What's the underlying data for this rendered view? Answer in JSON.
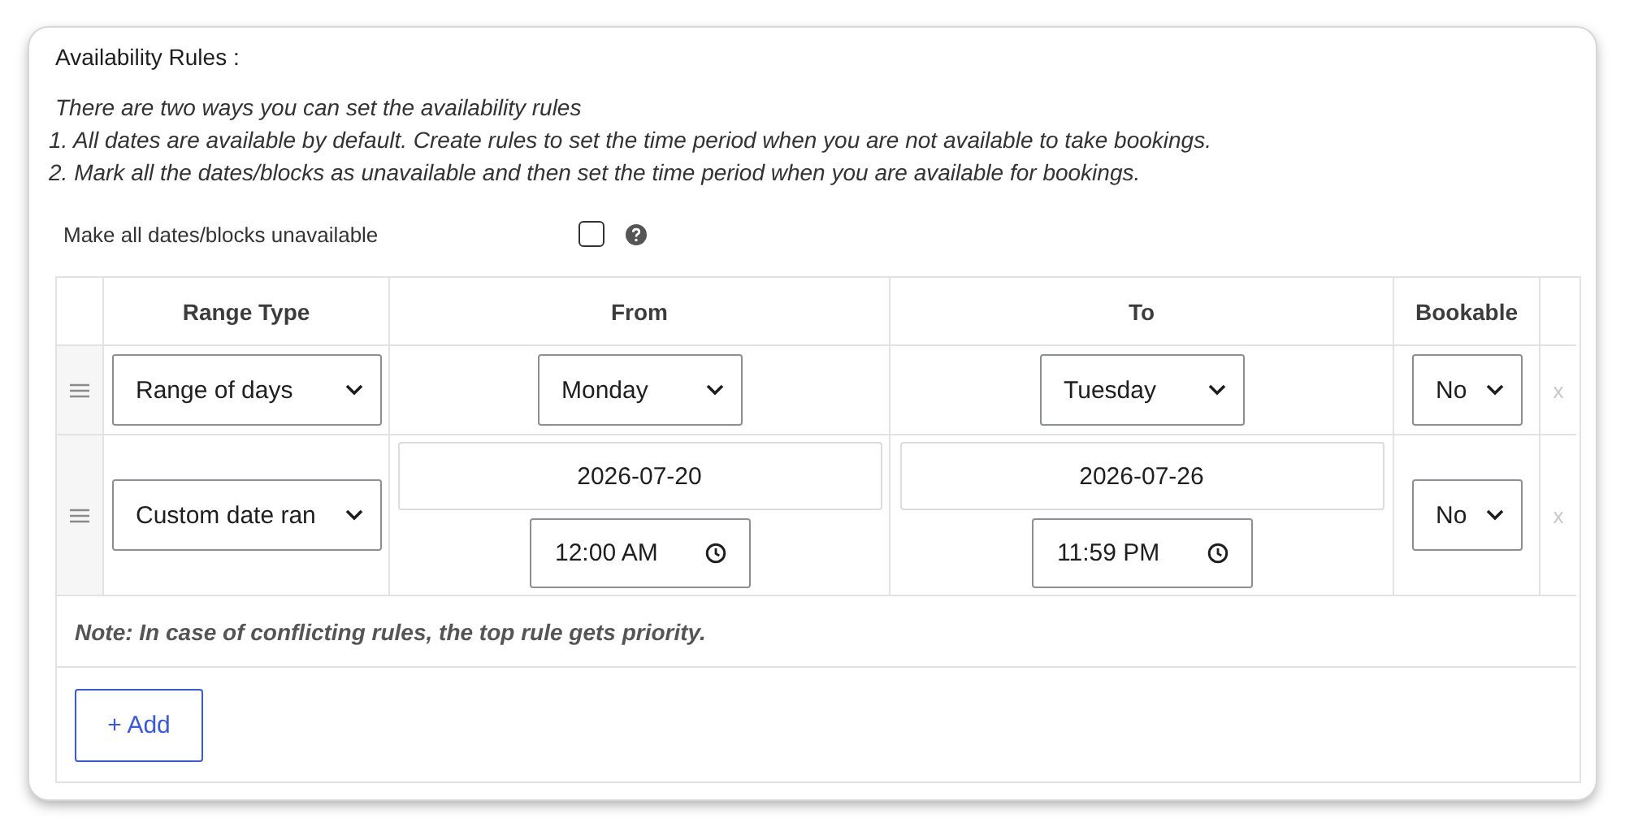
{
  "section_title": "Availability Rules :",
  "intro": [
    "There are two ways you can set the availability rules",
    "1. All dates are available by default. Create rules to set the time period when you are not available to take bookings.",
    "2. Mark all the dates/blocks as unavailable and then set the time period when you are available for bookings."
  ],
  "unavailable_option": {
    "label": "Make all dates/blocks unavailable",
    "checked": false
  },
  "table": {
    "columns": [
      "Range Type",
      "From",
      "To",
      "Bookable"
    ],
    "rows": [
      {
        "kind": "days",
        "range_type": "Range of days",
        "from": "Monday",
        "to": "Tuesday",
        "bookable": "No",
        "remove": "x"
      },
      {
        "kind": "custom",
        "range_type": "Custom date ran",
        "from": "2026-07-20",
        "from_time": "12:00 AM",
        "to": "2026-07-26",
        "to_time": "11:59 PM",
        "bookable": "No",
        "remove": "x"
      }
    ],
    "note": "Note: In case of conflicting rules, the top rule gets priority."
  },
  "add_button": "+ Add"
}
